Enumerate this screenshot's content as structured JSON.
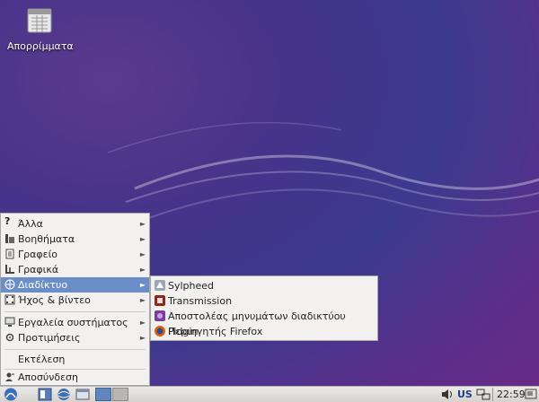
{
  "desktop": {
    "trash_label": "Απορρίμματα"
  },
  "menu": {
    "items": [
      {
        "label": "Άλλα",
        "icon": "question-icon"
      },
      {
        "label": "Βοηθήματα",
        "icon": "accessories-icon"
      },
      {
        "label": "Γραφείο",
        "icon": "office-icon"
      },
      {
        "label": "Γραφικά",
        "icon": "graphics-icon"
      },
      {
        "label": "Διαδίκτυο",
        "icon": "internet-icon"
      },
      {
        "label": "Ήχος & βίντεο",
        "icon": "multimedia-icon"
      },
      {
        "label": "Εργαλεία συστήματος",
        "icon": "system-tools-icon"
      },
      {
        "label": "Προτιμήσεις",
        "icon": "preferences-icon"
      }
    ],
    "run_label": "Εκτέλεση",
    "logout_label": "Αποσύνδεση"
  },
  "submenu": {
    "items": [
      {
        "label": "Sylpheed",
        "icon": "sylpheed-icon"
      },
      {
        "label": "Transmission",
        "icon": "transmission-icon"
      },
      {
        "label": "Αποστολέας μηνυμάτων διαδικτύου Pidgin",
        "icon": "pidgin-icon"
      },
      {
        "label": "Περιηγητής Firefox",
        "icon": "firefox-icon"
      }
    ]
  },
  "panel": {
    "keyboard_layout": "US",
    "clock": "22:59"
  },
  "colors": {
    "selection": "#6b8ec8",
    "menu_bg": "#f2f1f0"
  }
}
